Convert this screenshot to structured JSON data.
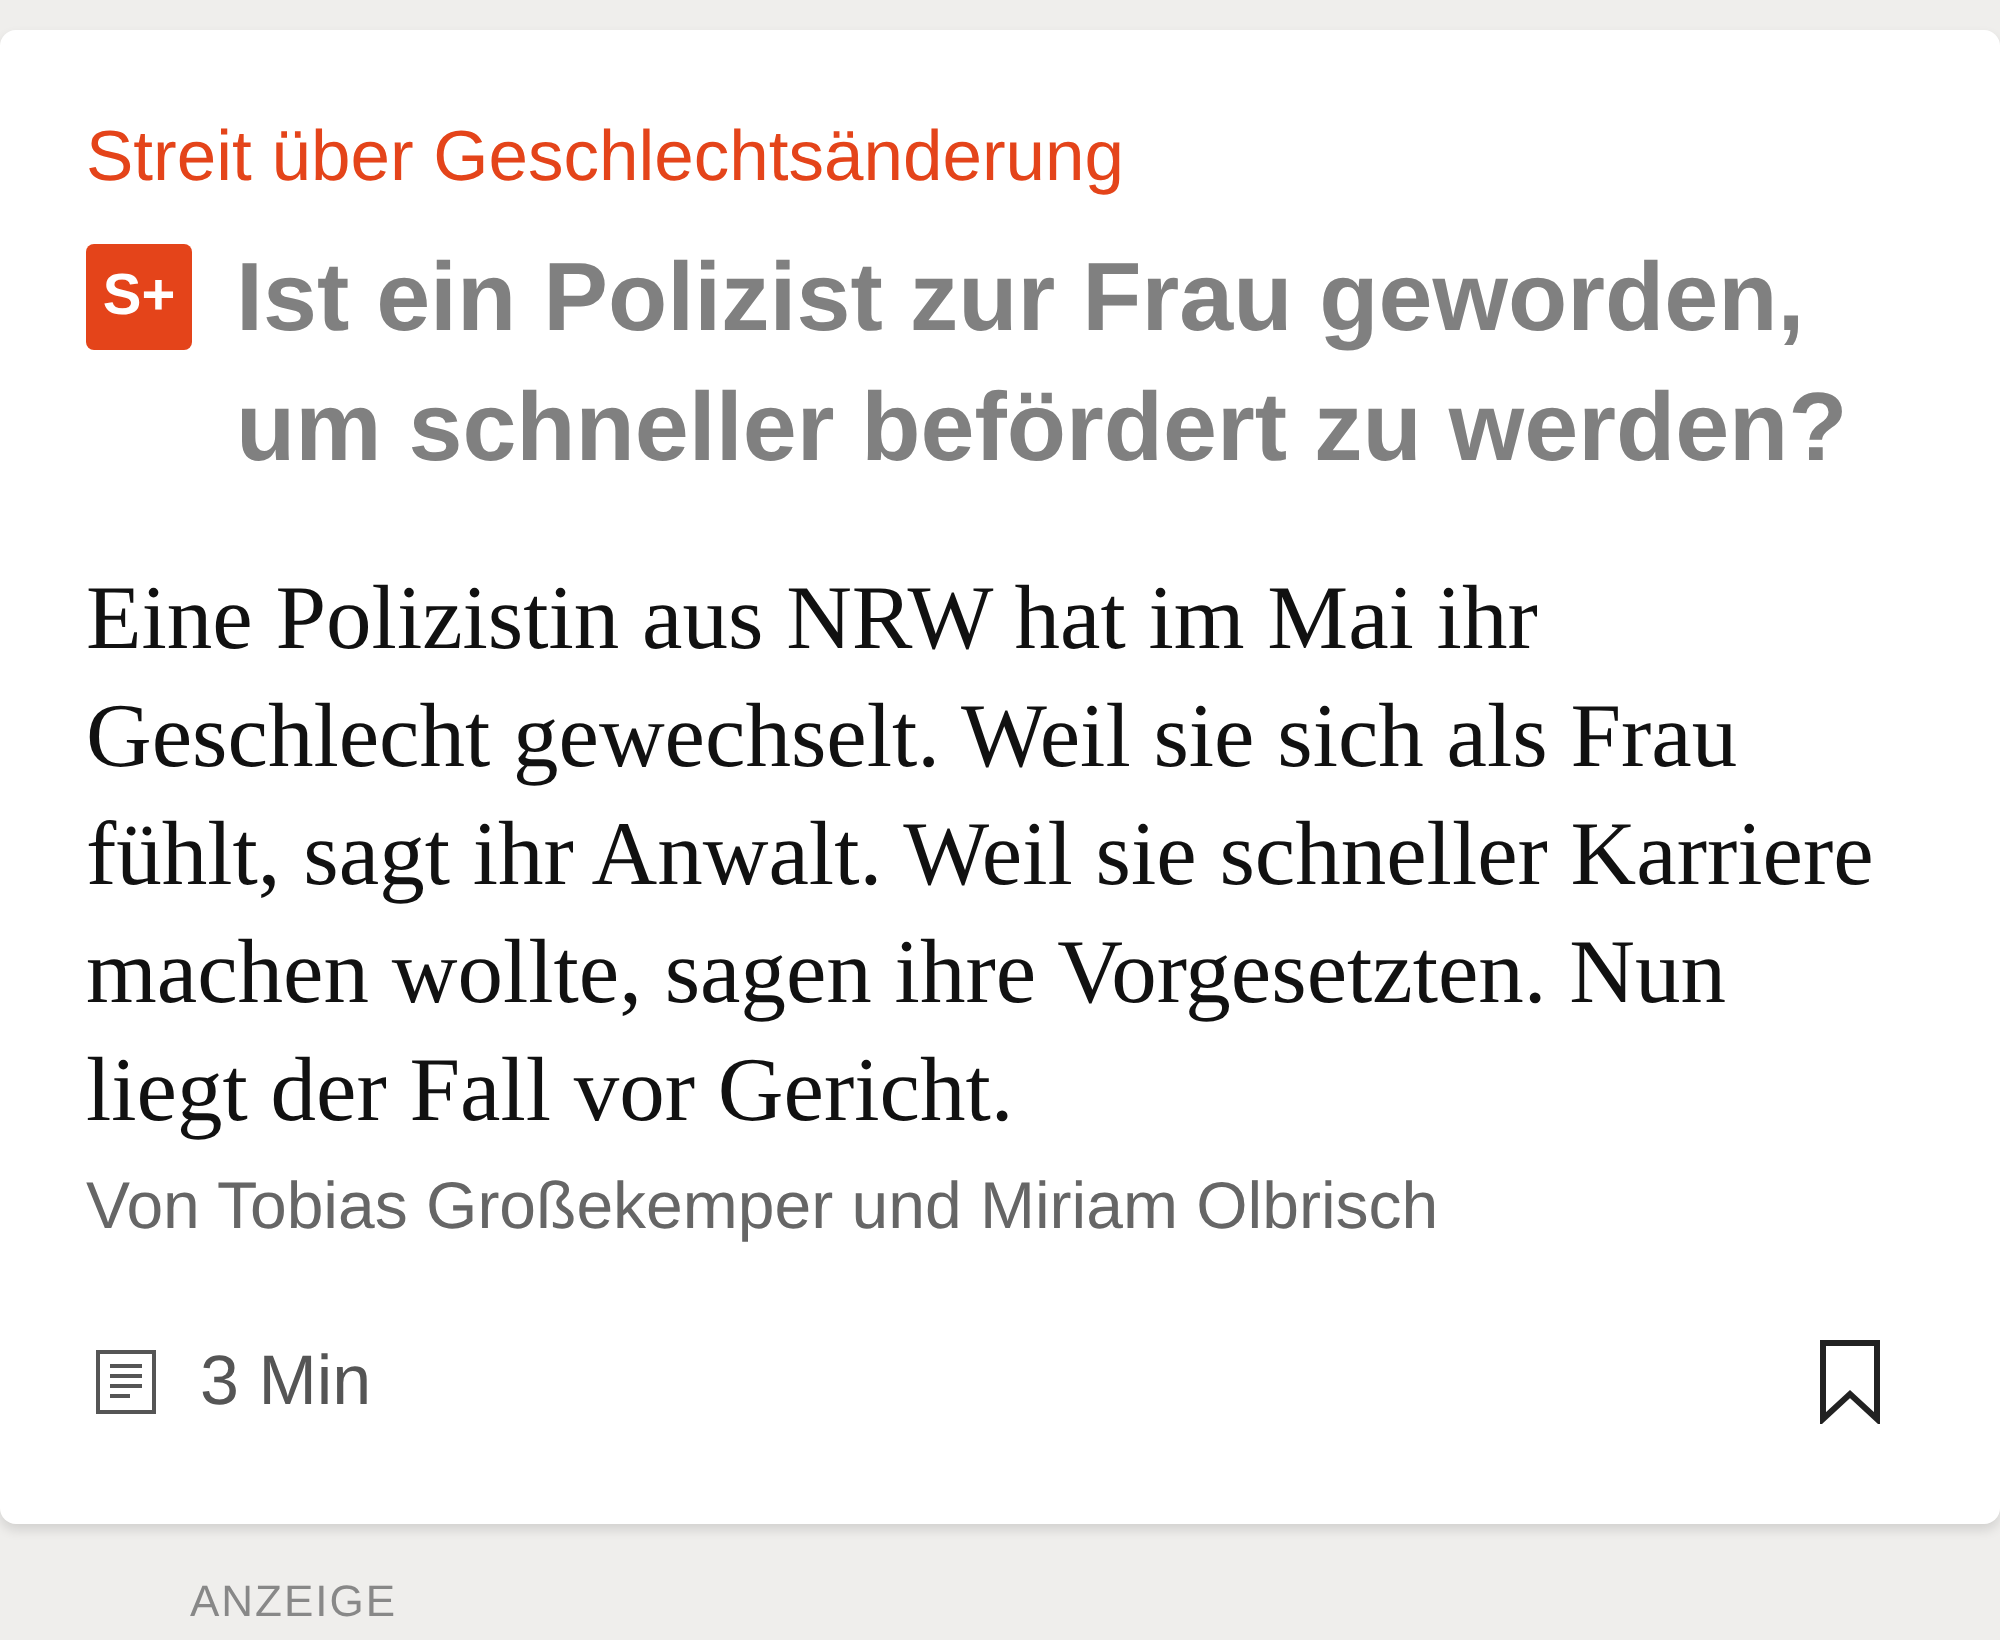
{
  "kicker": "Streit über Geschlechtsänderung",
  "headline": {
    "badge": "S+",
    "text": "Ist ein Polizist zur Frau geworden, um schneller befördert zu werden?"
  },
  "teaser": "Eine Polizistin aus NRW hat im Mai ihr Geschlecht gewechselt. Weil sie sich als Frau fühlt, sagt ihr Anwalt. Weil sie schneller Karriere machen wollte, sagen ihre Vorgesetzten. Nun liegt der Fall vor Gericht.",
  "byline": "Von Tobias Großekemper und Miriam Olbrisch",
  "reading_time": "3 Min",
  "bookmarked": false,
  "next_section": "ANZEIGE"
}
